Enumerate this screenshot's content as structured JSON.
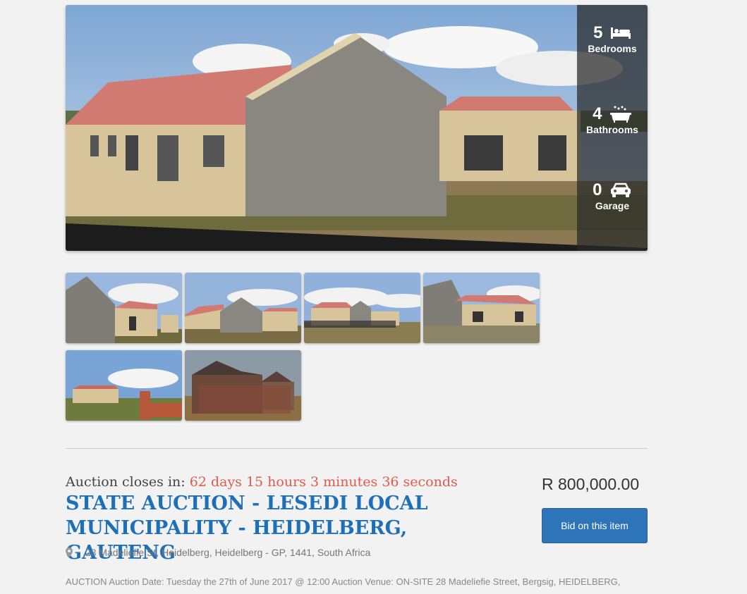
{
  "stats": {
    "bedrooms": {
      "count": "5",
      "label": "Bedrooms",
      "icon": "bed-icon"
    },
    "bathrooms": {
      "count": "4",
      "label": "Bathrooms",
      "icon": "bathtub-icon"
    },
    "garage": {
      "count": "0",
      "label": "Garage",
      "icon": "car-icon"
    }
  },
  "auction": {
    "closes_label": "Auction closes in:",
    "countdown": "62 days 15 hours 3 minutes 36 seconds",
    "title": "STATE AUCTION - LESEDI LOCAL MUNICIPALITY - HEIDELBERG, GAUTENG",
    "price": "R 800,000.00",
    "bid_button": "Bid on this item",
    "address": "28 Madeliefie St, Heidelberg, Heidelberg - GP, 1441, South Africa",
    "description": "AUCTION Auction Date: Tuesday the 27th of June 2017 @ 12:00 Auction Venue: ON-SITE 28 Madeliefie Street, Bergsig, HEIDELBERG,"
  },
  "colors": {
    "title": "#1d6fb8",
    "countdown": "#e05a4e",
    "button": "#2e74b8"
  }
}
